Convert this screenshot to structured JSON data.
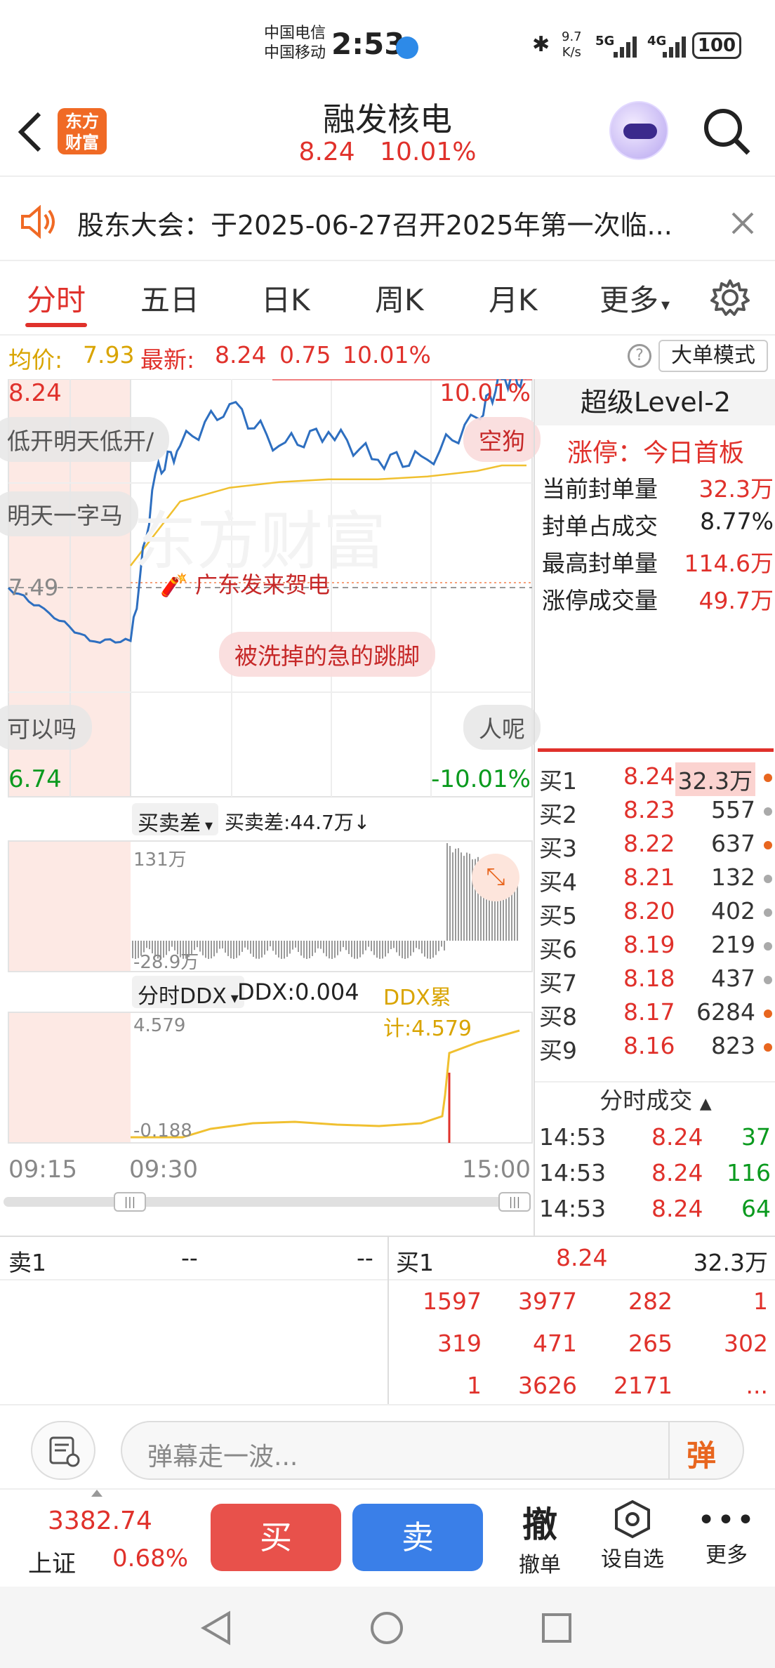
{
  "status_bar": {
    "carrier1": "中国电信",
    "carrier2": "中国移动",
    "time": "2:53",
    "net_speed_value": "9.7",
    "net_speed_unit": "K/s",
    "net1": "5G",
    "net2": "4G",
    "battery": "100"
  },
  "header": {
    "stock_name": "融发核电",
    "price": "8.24",
    "change_pct": "10.01%",
    "logo_line1": "东方",
    "logo_line2": "财富"
  },
  "notice": {
    "text": "股东大会：于2025-06-27召开2025年第一次临..."
  },
  "tabs": [
    "分时",
    "五日",
    "日K",
    "周K",
    "月K",
    "更多"
  ],
  "summary": {
    "avg_label": "均价:",
    "avg_value": "7.93",
    "latest_label": "最新:",
    "latest_value": "8.24",
    "change": "0.75",
    "change_pct": "10.01%",
    "mode_button": "大单模式"
  },
  "chart": {
    "y_top": "8.24",
    "y_top_pct": "10.01%",
    "y_mid": "7.49",
    "y_bottom": "6.74",
    "y_bottom_pct": "-10.01%",
    "event_label": "广东发来贺电",
    "bubbles": [
      "低开明天低开/",
      "明天一字马",
      "空狗",
      "被洗掉的急的跳脚",
      "可以吗",
      "人呢"
    ],
    "sub1_selector": "买卖差",
    "sub1_value": "买卖差:44.7万↓",
    "sub1_max": "131万",
    "sub1_min": "-28.9万",
    "sub2_selector": "分时DDX",
    "sub2_ddx": "DDX:0.004",
    "sub2_ddx_cum": "DDX累计:4.579",
    "sub2_max": "4.579",
    "sub2_min": "-0.188",
    "time_labels": [
      "09:15",
      "09:30",
      "15:00"
    ]
  },
  "chart_data": {
    "type": "line",
    "title": "",
    "xlabel": "",
    "ylabel": "",
    "ylim": [
      6.74,
      8.24
    ],
    "series": [
      {
        "name": "最新",
        "x": [
          "09:15",
          "09:20",
          "09:25",
          "09:30",
          "09:45",
          "10:00",
          "10:30",
          "11:00",
          "11:30",
          "13:30",
          "14:00",
          "14:30",
          "14:45",
          "15:00"
        ],
        "values": [
          7.49,
          7.4,
          7.3,
          7.3,
          7.9,
          8.0,
          8.15,
          8.0,
          8.05,
          7.95,
          7.95,
          8.1,
          8.24,
          8.24
        ]
      },
      {
        "name": "均价",
        "x": [
          "09:30",
          "10:00",
          "10:30",
          "11:00",
          "11:30",
          "13:30",
          "14:00",
          "14:30",
          "14:45",
          "15:00"
        ],
        "values": [
          7.57,
          7.8,
          7.85,
          7.87,
          7.88,
          7.88,
          7.89,
          7.91,
          7.93,
          7.93
        ]
      }
    ]
  },
  "level2": {
    "title": "超级Level-2",
    "limit_status": "涨停：今日首板",
    "rows": [
      {
        "label": "当前封单量",
        "value": "32.3万"
      },
      {
        "label": "封单占成交",
        "value": "8.77%"
      },
      {
        "label": "最高封单量",
        "value": "114.6万"
      },
      {
        "label": "涨停成交量",
        "value": "49.7万"
      }
    ],
    "bids": [
      {
        "name": "买1",
        "price": "8.24",
        "qty": "32.3万",
        "dot": "#e8661f"
      },
      {
        "name": "买2",
        "price": "8.23",
        "qty": "557",
        "dot": "#aaaaaa"
      },
      {
        "name": "买3",
        "price": "8.22",
        "qty": "637",
        "dot": "#e8661f"
      },
      {
        "name": "买4",
        "price": "8.21",
        "qty": "132",
        "dot": "#aaaaaa"
      },
      {
        "name": "买5",
        "price": "8.20",
        "qty": "402",
        "dot": "#aaaaaa"
      },
      {
        "name": "买6",
        "price": "8.19",
        "qty": "219",
        "dot": "#aaaaaa"
      },
      {
        "name": "买7",
        "price": "8.18",
        "qty": "437",
        "dot": "#aaaaaa"
      },
      {
        "name": "买8",
        "price": "8.17",
        "qty": "6284",
        "dot": "#e8661f"
      },
      {
        "name": "买9",
        "price": "8.16",
        "qty": "823",
        "dot": "#e8661f"
      }
    ],
    "trades_title": "分时成交",
    "trades": [
      {
        "time": "14:53",
        "price": "8.24",
        "qty": "37"
      },
      {
        "time": "14:53",
        "price": "8.24",
        "qty": "116"
      },
      {
        "time": "14:53",
        "price": "8.24",
        "qty": "64"
      }
    ]
  },
  "depth": {
    "sell_label": "卖1",
    "sell_price": "--",
    "sell_qty": "--",
    "buy_label": "买1",
    "buy_price": "8.24",
    "buy_qty": "32.3万",
    "queue": [
      [
        "1597",
        "3977",
        "282",
        "1"
      ],
      [
        "319",
        "471",
        "265",
        "302"
      ],
      [
        "1",
        "3626",
        "2171",
        "..."
      ]
    ]
  },
  "input": {
    "placeholder": "弹幕走一波...",
    "danmu_button": "弹"
  },
  "trade_bar": {
    "index_value": "3382.74",
    "index_name": "上证",
    "index_pct": "0.68%",
    "buy": "买",
    "sell": "卖",
    "cancel_icon_text": "撤",
    "cancel": "撤单",
    "watchlist": "设自选",
    "more": "更多"
  }
}
